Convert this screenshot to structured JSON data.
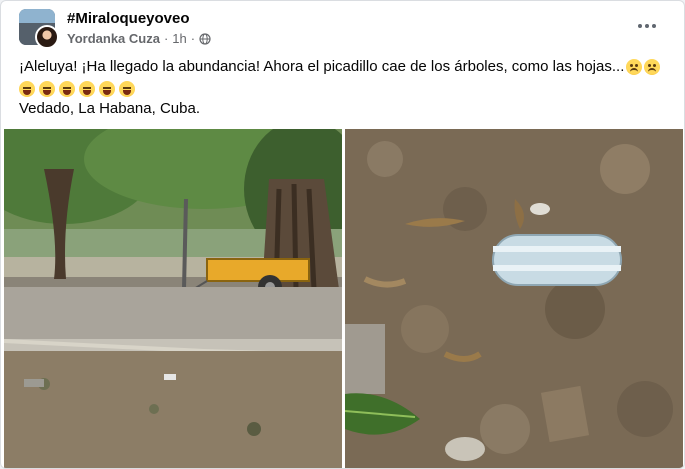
{
  "post": {
    "group_name": "#Miraloqueyoveo",
    "author": "Yordanka Cuza",
    "separator": "·",
    "time": "1h",
    "text_line1": "¡Aleluya! ¡Ha llegado la abundancia! Ahora el picadillo cae de los árboles,  como las hojas...",
    "text_line3": "Vedado, La Habana, Cuba.",
    "line1_emojis": [
      "worried-face-icon",
      "unamused-face-icon"
    ],
    "line2_emojis": [
      "laughing-face-icon",
      "laughing-face-icon",
      "laughing-face-icon",
      "laughing-face-icon",
      "laughing-face-icon",
      "laughing-face-icon"
    ]
  },
  "icons": {
    "audience": "globe-icon",
    "more": "more-options-icon"
  },
  "photos": [
    {
      "subject": "street with trees and yellow trailer"
    },
    {
      "subject": "package of ground meat on the ground"
    }
  ],
  "colors": {
    "name_text": "#050505",
    "meta_text": "#65676b",
    "card_bg": "#ffffff",
    "page_bg": "#f0f2f5"
  }
}
